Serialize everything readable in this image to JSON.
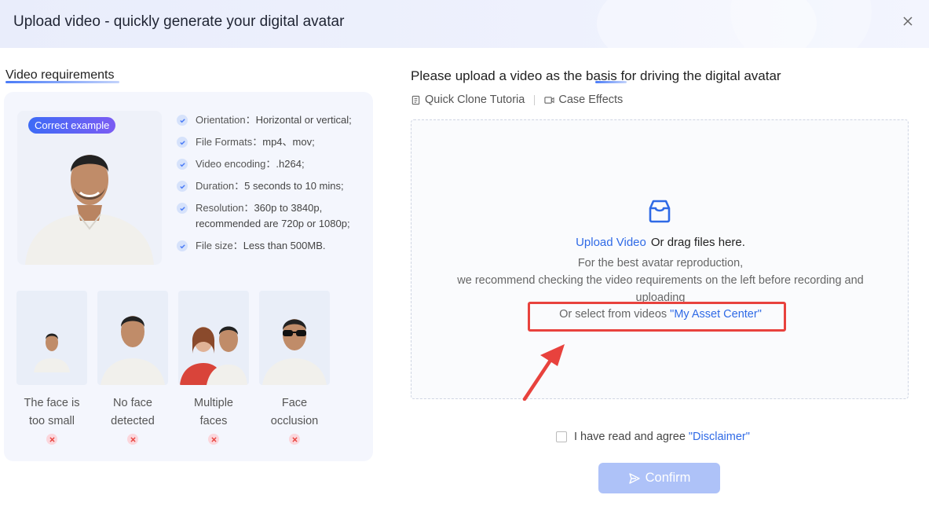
{
  "header": {
    "title": "Upload video - quickly generate your digital avatar"
  },
  "requirements": {
    "title": "Video requirements",
    "badge": "Correct example",
    "items": [
      {
        "label": "Orientation：",
        "value": "Horizontal or vertical;"
      },
      {
        "label": "File Formats：",
        "value": "mp4、mov;"
      },
      {
        "label": "Video encoding：",
        "value": ".h264;"
      },
      {
        "label": "Duration：",
        "value": "5 seconds to 10 mins;"
      },
      {
        "label": "Resolution：",
        "value": "360p to 3840p, recommended are 720p or 1080p;"
      },
      {
        "label": "File size：",
        "value": "Less than 500MB."
      }
    ],
    "bad_examples": [
      {
        "line1": "The face is",
        "line2": "too small"
      },
      {
        "line1": "No face",
        "line2": "detected"
      },
      {
        "line1": "Multiple",
        "line2": "faces"
      },
      {
        "line1": "Face",
        "line2": "occlusion"
      }
    ]
  },
  "upload": {
    "heading": "Please upload a video as the basis for driving the digital avatar",
    "tutorial_link": "Quick Clone Tutoria",
    "case_link": "Case Effects",
    "upload_link": "Upload Video",
    "drag_text": "Or drag files here.",
    "hint1": "For the best avatar reproduction,",
    "hint2": "we recommend checking the video requirements on the left before recording and",
    "hint3": "uploading",
    "asset_prefix": "Or select from videos ",
    "asset_link": "\"My Asset Center\""
  },
  "agree": {
    "text": "I have read and agree",
    "link": "\"Disclaimer\""
  },
  "confirm_label": "Confirm",
  "colors": {
    "accent": "#2f6ae6",
    "highlight": "#e8423d",
    "confirm_bg": "#aec2f8"
  }
}
